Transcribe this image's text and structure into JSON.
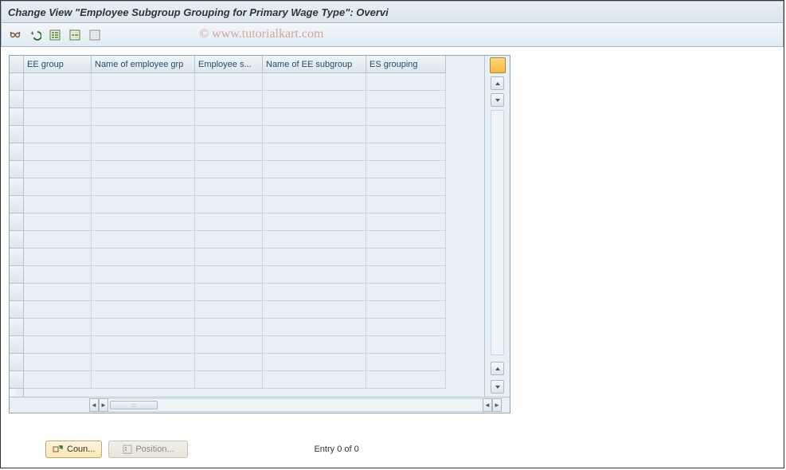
{
  "window": {
    "title": "Change View \"Employee Subgroup Grouping for Primary Wage Type\": Overvi"
  },
  "toolbar": {
    "icons": [
      "glasses-icon",
      "undo-icon",
      "select-all-icon",
      "select-block-icon",
      "deselect-all-icon"
    ]
  },
  "table": {
    "columns": [
      {
        "label": "EE group"
      },
      {
        "label": "Name of employee grp"
      },
      {
        "label": "Employee s..."
      },
      {
        "label": "Name of EE subgroup"
      },
      {
        "label": "ES grouping"
      }
    ],
    "row_count": 18,
    "config_icon": "table-settings-icon"
  },
  "footer": {
    "country_button": "Coun...",
    "position_button": "Position...",
    "entry_status": "Entry 0 of 0"
  },
  "watermark": "© www.tutorialkart.com"
}
